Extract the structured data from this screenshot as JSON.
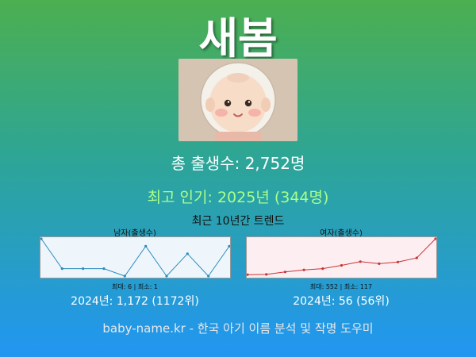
{
  "name": "새봄",
  "total_births": "총 출생수: 2,752명",
  "peak": "최고 인기: 2025년 (344명)",
  "trend_title": "최근 10년간 트렌드",
  "male": {
    "label": "남자(출생수)",
    "minmax": "최대: 6 | 최소: 1",
    "stat": "2024년: 1,172 (1172위)",
    "color": "#2a8bbf"
  },
  "female": {
    "label": "여자(출생수)",
    "minmax": "최대: 552 | 최소: 117",
    "stat": "2024년: 56 (56위)",
    "color": "#c93535"
  },
  "footer": "baby-name.kr - 한국 아기 이름 분석 및 작명 도우미",
  "chart_data": [
    {
      "type": "line",
      "series": [
        {
          "name": "남자(출생수)",
          "values": [
            6,
            2,
            2,
            2,
            1,
            5,
            1,
            4,
            1,
            5
          ]
        }
      ],
      "ylim": [
        1,
        6
      ]
    },
    {
      "type": "line",
      "series": [
        {
          "name": "여자(출생수)",
          "values": [
            117,
            120,
            150,
            175,
            190,
            230,
            275,
            250,
            270,
            320,
            552
          ]
        }
      ],
      "ylim": [
        100,
        552
      ]
    }
  ]
}
